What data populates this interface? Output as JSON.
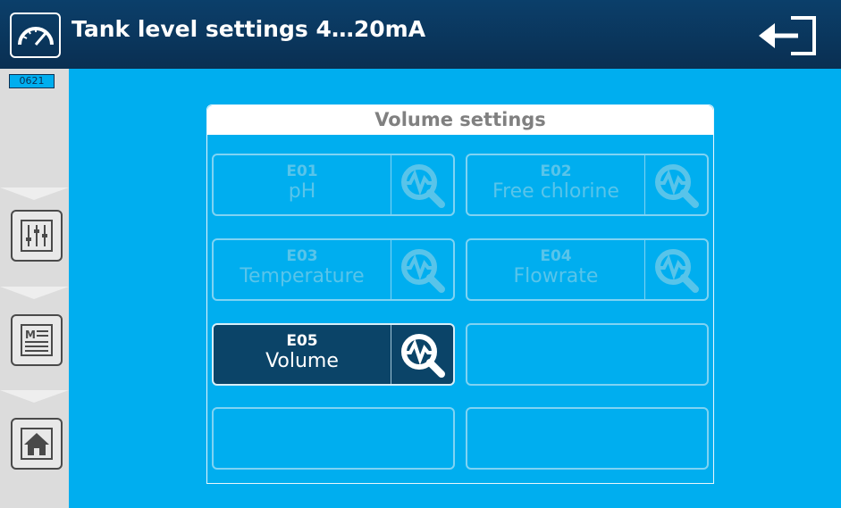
{
  "header": {
    "title": "Tank level settings 4…20mA",
    "title_icon": "gauge-icon",
    "exit_icon": "exit-icon"
  },
  "sidebar": {
    "code": "0621",
    "buttons": [
      {
        "icon": "sliders-icon"
      },
      {
        "icon": "menu-list-icon"
      },
      {
        "icon": "home-icon"
      }
    ]
  },
  "panel": {
    "title": "Volume settings",
    "tiles": [
      {
        "code": "E01",
        "name": "pH",
        "enabled": false
      },
      {
        "code": "E02",
        "name": "Free chlorine",
        "enabled": false
      },
      {
        "code": "E03",
        "name": "Temperature",
        "enabled": false
      },
      {
        "code": "E04",
        "name": "Flowrate",
        "enabled": false
      },
      {
        "code": "E05",
        "name": "Volume",
        "enabled": true
      },
      {
        "code": "",
        "name": "",
        "enabled": false
      },
      {
        "code": "",
        "name": "",
        "enabled": false
      },
      {
        "code": "",
        "name": "",
        "enabled": false
      }
    ]
  },
  "colors": {
    "background": "#00aeef",
    "header": "#0a2f52",
    "active_tile": "#0b4468",
    "disabled_text": "#58c4ea"
  }
}
